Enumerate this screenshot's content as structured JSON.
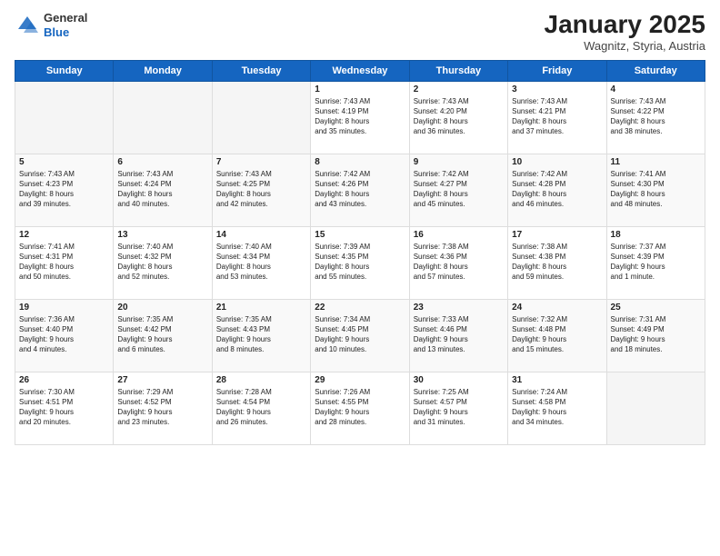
{
  "logo": {
    "general": "General",
    "blue": "Blue"
  },
  "title": "January 2025",
  "location": "Wagnitz, Styria, Austria",
  "days_header": [
    "Sunday",
    "Monday",
    "Tuesday",
    "Wednesday",
    "Thursday",
    "Friday",
    "Saturday"
  ],
  "weeks": [
    [
      {
        "day": "",
        "text": ""
      },
      {
        "day": "",
        "text": ""
      },
      {
        "day": "",
        "text": ""
      },
      {
        "day": "1",
        "text": "Sunrise: 7:43 AM\nSunset: 4:19 PM\nDaylight: 8 hours\nand 35 minutes."
      },
      {
        "day": "2",
        "text": "Sunrise: 7:43 AM\nSunset: 4:20 PM\nDaylight: 8 hours\nand 36 minutes."
      },
      {
        "day": "3",
        "text": "Sunrise: 7:43 AM\nSunset: 4:21 PM\nDaylight: 8 hours\nand 37 minutes."
      },
      {
        "day": "4",
        "text": "Sunrise: 7:43 AM\nSunset: 4:22 PM\nDaylight: 8 hours\nand 38 minutes."
      }
    ],
    [
      {
        "day": "5",
        "text": "Sunrise: 7:43 AM\nSunset: 4:23 PM\nDaylight: 8 hours\nand 39 minutes."
      },
      {
        "day": "6",
        "text": "Sunrise: 7:43 AM\nSunset: 4:24 PM\nDaylight: 8 hours\nand 40 minutes."
      },
      {
        "day": "7",
        "text": "Sunrise: 7:43 AM\nSunset: 4:25 PM\nDaylight: 8 hours\nand 42 minutes."
      },
      {
        "day": "8",
        "text": "Sunrise: 7:42 AM\nSunset: 4:26 PM\nDaylight: 8 hours\nand 43 minutes."
      },
      {
        "day": "9",
        "text": "Sunrise: 7:42 AM\nSunset: 4:27 PM\nDaylight: 8 hours\nand 45 minutes."
      },
      {
        "day": "10",
        "text": "Sunrise: 7:42 AM\nSunset: 4:28 PM\nDaylight: 8 hours\nand 46 minutes."
      },
      {
        "day": "11",
        "text": "Sunrise: 7:41 AM\nSunset: 4:30 PM\nDaylight: 8 hours\nand 48 minutes."
      }
    ],
    [
      {
        "day": "12",
        "text": "Sunrise: 7:41 AM\nSunset: 4:31 PM\nDaylight: 8 hours\nand 50 minutes."
      },
      {
        "day": "13",
        "text": "Sunrise: 7:40 AM\nSunset: 4:32 PM\nDaylight: 8 hours\nand 52 minutes."
      },
      {
        "day": "14",
        "text": "Sunrise: 7:40 AM\nSunset: 4:34 PM\nDaylight: 8 hours\nand 53 minutes."
      },
      {
        "day": "15",
        "text": "Sunrise: 7:39 AM\nSunset: 4:35 PM\nDaylight: 8 hours\nand 55 minutes."
      },
      {
        "day": "16",
        "text": "Sunrise: 7:38 AM\nSunset: 4:36 PM\nDaylight: 8 hours\nand 57 minutes."
      },
      {
        "day": "17",
        "text": "Sunrise: 7:38 AM\nSunset: 4:38 PM\nDaylight: 8 hours\nand 59 minutes."
      },
      {
        "day": "18",
        "text": "Sunrise: 7:37 AM\nSunset: 4:39 PM\nDaylight: 9 hours\nand 1 minute."
      }
    ],
    [
      {
        "day": "19",
        "text": "Sunrise: 7:36 AM\nSunset: 4:40 PM\nDaylight: 9 hours\nand 4 minutes."
      },
      {
        "day": "20",
        "text": "Sunrise: 7:35 AM\nSunset: 4:42 PM\nDaylight: 9 hours\nand 6 minutes."
      },
      {
        "day": "21",
        "text": "Sunrise: 7:35 AM\nSunset: 4:43 PM\nDaylight: 9 hours\nand 8 minutes."
      },
      {
        "day": "22",
        "text": "Sunrise: 7:34 AM\nSunset: 4:45 PM\nDaylight: 9 hours\nand 10 minutes."
      },
      {
        "day": "23",
        "text": "Sunrise: 7:33 AM\nSunset: 4:46 PM\nDaylight: 9 hours\nand 13 minutes."
      },
      {
        "day": "24",
        "text": "Sunrise: 7:32 AM\nSunset: 4:48 PM\nDaylight: 9 hours\nand 15 minutes."
      },
      {
        "day": "25",
        "text": "Sunrise: 7:31 AM\nSunset: 4:49 PM\nDaylight: 9 hours\nand 18 minutes."
      }
    ],
    [
      {
        "day": "26",
        "text": "Sunrise: 7:30 AM\nSunset: 4:51 PM\nDaylight: 9 hours\nand 20 minutes."
      },
      {
        "day": "27",
        "text": "Sunrise: 7:29 AM\nSunset: 4:52 PM\nDaylight: 9 hours\nand 23 minutes."
      },
      {
        "day": "28",
        "text": "Sunrise: 7:28 AM\nSunset: 4:54 PM\nDaylight: 9 hours\nand 26 minutes."
      },
      {
        "day": "29",
        "text": "Sunrise: 7:26 AM\nSunset: 4:55 PM\nDaylight: 9 hours\nand 28 minutes."
      },
      {
        "day": "30",
        "text": "Sunrise: 7:25 AM\nSunset: 4:57 PM\nDaylight: 9 hours\nand 31 minutes."
      },
      {
        "day": "31",
        "text": "Sunrise: 7:24 AM\nSunset: 4:58 PM\nDaylight: 9 hours\nand 34 minutes."
      },
      {
        "day": "",
        "text": ""
      }
    ]
  ]
}
